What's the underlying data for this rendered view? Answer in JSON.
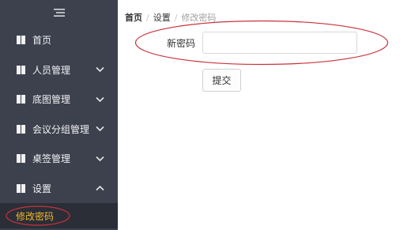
{
  "sidebar": {
    "toggle_icon": "hamburger-menu-icon",
    "background": "#3d414e",
    "items": [
      {
        "label": "首页",
        "icon": "square-icon",
        "chevron": "none"
      },
      {
        "label": "人员管理",
        "icon": "square-icon",
        "chevron": "down"
      },
      {
        "label": "底图管理",
        "icon": "square-icon",
        "chevron": "down"
      },
      {
        "label": "会议分组管理",
        "icon": "square-icon",
        "chevron": "down"
      },
      {
        "label": "桌签管理",
        "icon": "square-icon",
        "chevron": "down"
      },
      {
        "label": "设置",
        "icon": "square-icon",
        "chevron": "up",
        "expanded": true
      }
    ],
    "active_subitem": {
      "label": "修改密码",
      "color": "#f0b52a"
    }
  },
  "breadcrumb": {
    "home": "首页",
    "separator": "/",
    "settings": "设置",
    "current": "修改密码"
  },
  "form": {
    "new_password_label": "新密码",
    "new_password_value": "",
    "submit_label": "提交"
  },
  "annotation_color": "#c8323c"
}
